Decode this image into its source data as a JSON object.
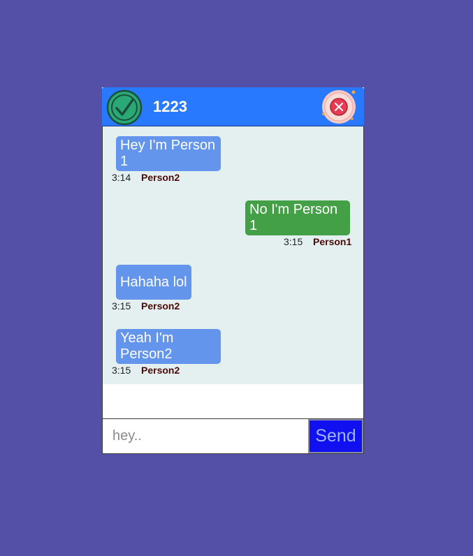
{
  "header": {
    "title": "1223",
    "status_icon": "check-circle-icon",
    "close_icon": "close-icon"
  },
  "messages": [
    {
      "text": "Hey I'm Person 1",
      "time": "3:14",
      "author": "Person2",
      "side": "left"
    },
    {
      "text": "No I'm Person 1",
      "time": "3:15",
      "author": "Person1",
      "side": "right"
    },
    {
      "text": "Hahaha lol",
      "time": "3:15",
      "author": "Person2",
      "side": "left"
    },
    {
      "text": "Yeah I'm Person2",
      "time": "3:15",
      "author": "Person2",
      "side": "left"
    }
  ],
  "composer": {
    "placeholder": "hey..",
    "value": "",
    "send_label": "Send"
  },
  "colors": {
    "page_background": "#5450a8",
    "header": "#2979ff",
    "incoming_bubble": "#6495ed",
    "outgoing_bubble": "#43a047",
    "messages_background": "#e4f0ef",
    "send_button": "#1010f0"
  }
}
